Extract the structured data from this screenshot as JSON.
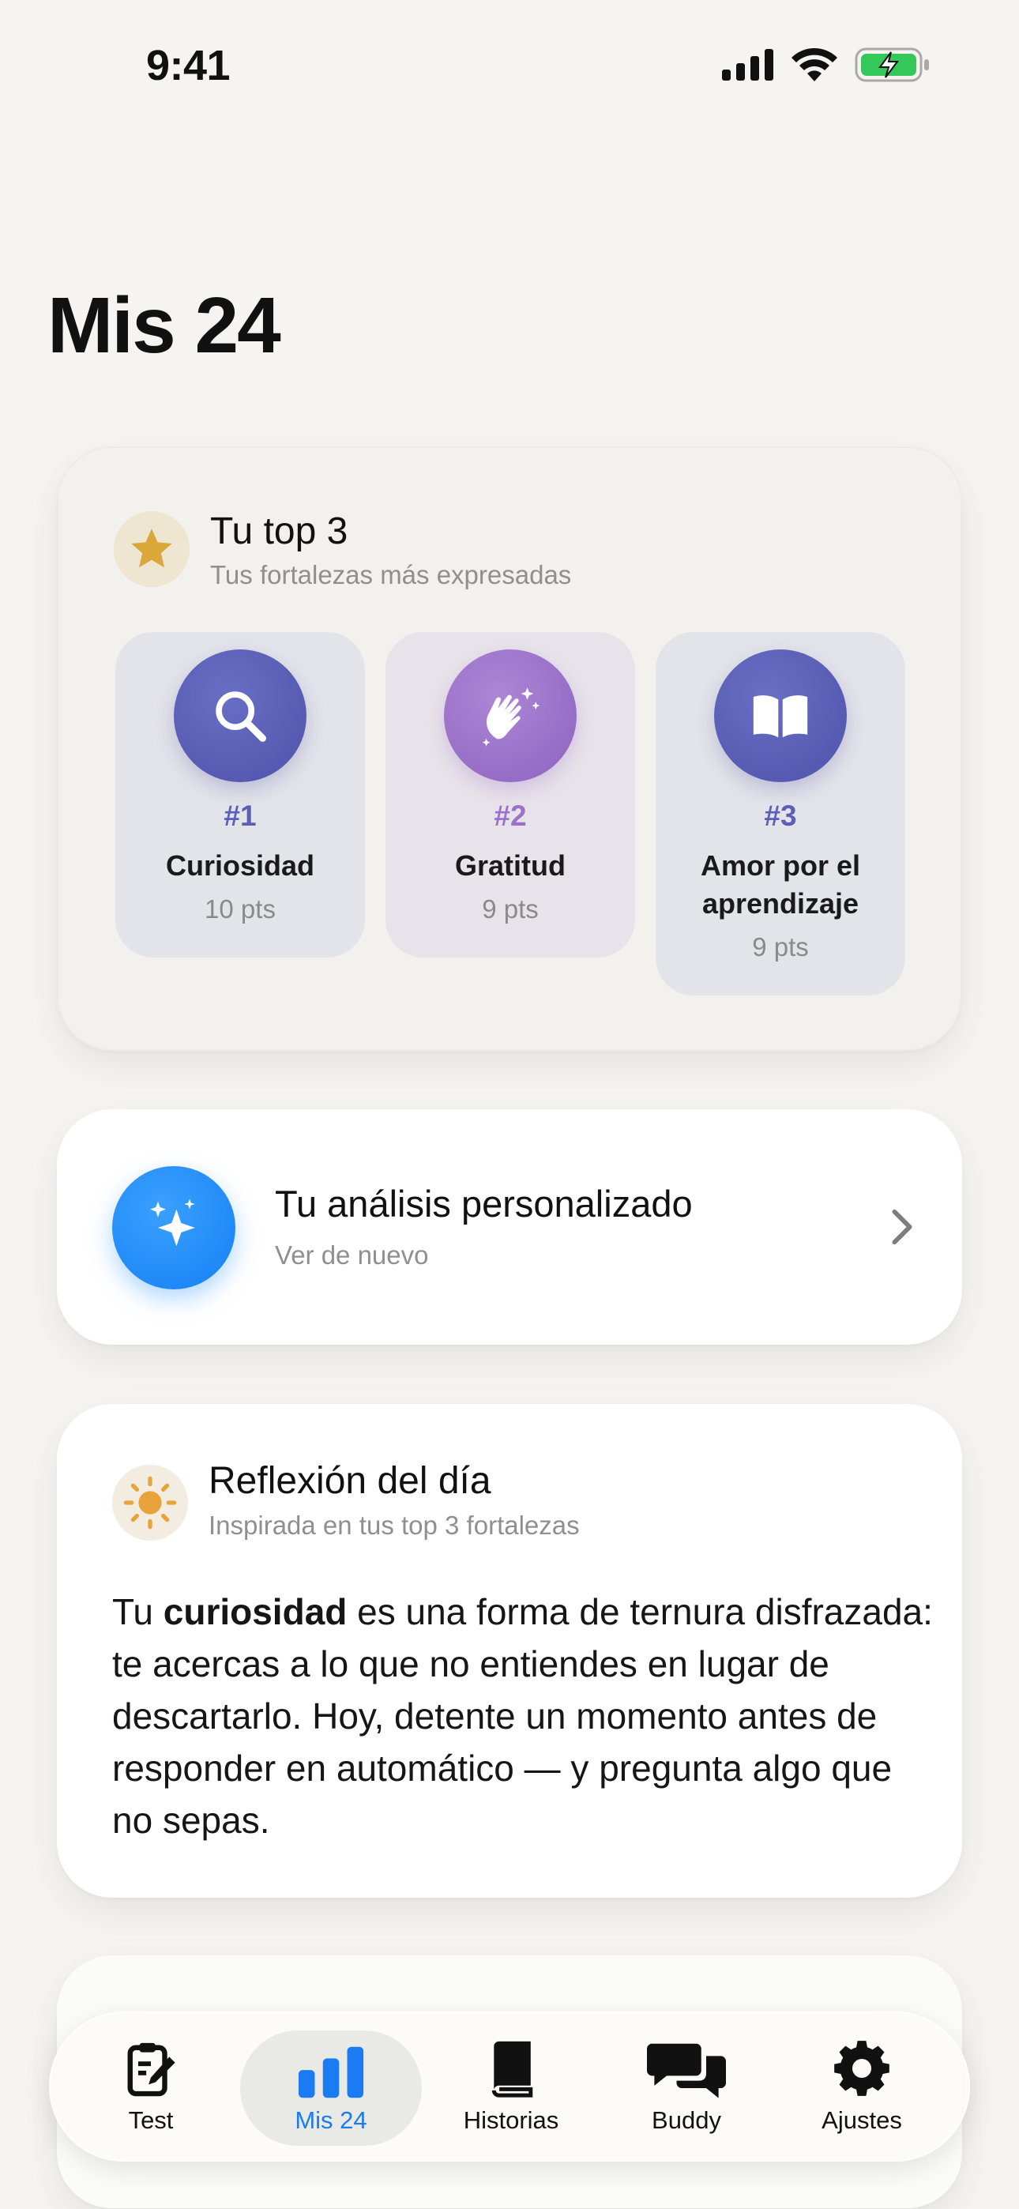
{
  "status_bar": {
    "time": "9:41"
  },
  "page": {
    "title": "Mis 24"
  },
  "top3": {
    "title": "Tu top 3",
    "subtitle": "Tus fortalezas más expresadas",
    "items": [
      {
        "rank": "#1",
        "name": "Curiosidad",
        "points": "10 pts",
        "icon": "magnifier-icon",
        "color": "#5b5fb8"
      },
      {
        "rank": "#2",
        "name": "Gratitud",
        "points": "9 pts",
        "icon": "clapping-hands-icon",
        "color": "#9b72c9"
      },
      {
        "rank": "#3",
        "name": "Amor por el aprendizaje",
        "points": "9 pts",
        "icon": "open-book-icon",
        "color": "#5b5fb8"
      }
    ]
  },
  "analysis": {
    "title": "Tu análisis personalizado",
    "subtitle": "Ver de nuevo",
    "icon": "sparkles-icon",
    "color": "#1e8bff"
  },
  "reflection": {
    "title": "Reflexión del día",
    "subtitle": "Inspirada en tus top 3 fortalezas",
    "text_lead": "Tu ",
    "text_bold": "curiosidad",
    "text_rest": " es una forma de ternura disfrazada: te acercas a lo que no entiendes en lugar de descartarlo. Hoy, detente un momento antes de responder en automático — y pregunta algo que no sepas.",
    "icon": "sun-icon"
  },
  "tabs": [
    {
      "label": "Test",
      "icon": "clipboard-pencil-icon",
      "active": false
    },
    {
      "label": "Mis 24",
      "icon": "bar-chart-icon",
      "active": true
    },
    {
      "label": "Historias",
      "icon": "book-icon",
      "active": false
    },
    {
      "label": "Buddy",
      "icon": "chat-bubbles-icon",
      "active": false
    },
    {
      "label": "Ajustes",
      "icon": "gear-icon",
      "active": false
    }
  ],
  "colors": {
    "accent": "#1a7bf2",
    "background": "#f5f4f1",
    "star": "#d9a73a"
  }
}
